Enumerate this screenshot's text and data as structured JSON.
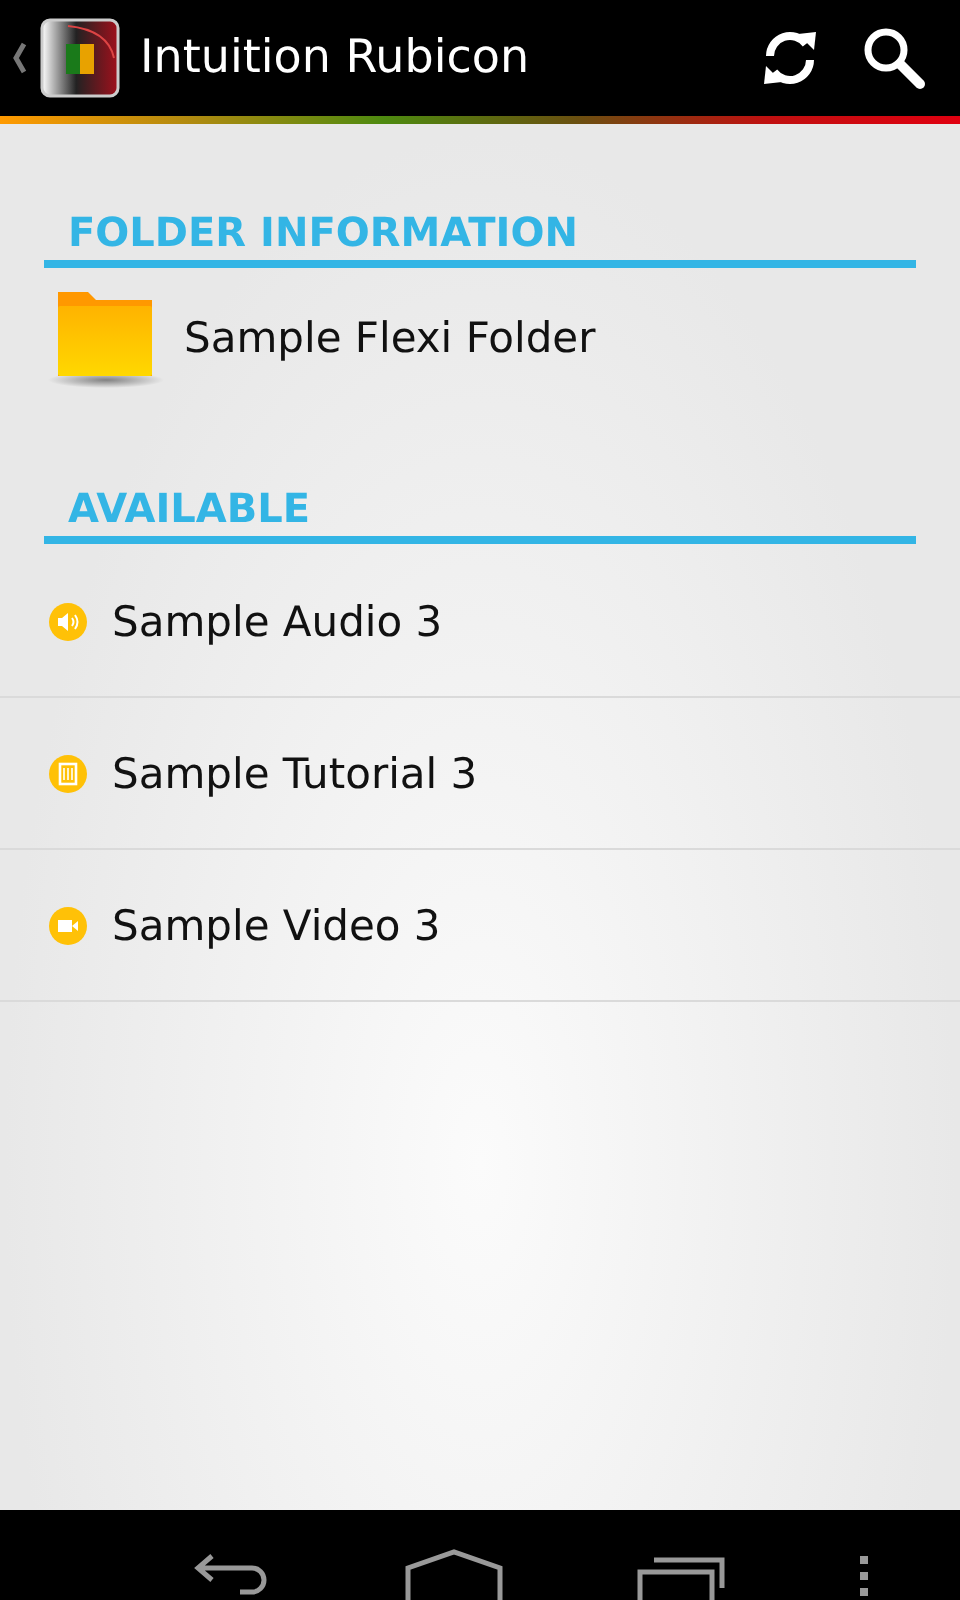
{
  "action_bar": {
    "title": "Intuition Rubicon"
  },
  "folder_section": {
    "heading": "FOLDER INFORMATION",
    "folder_name": "Sample Flexi Folder"
  },
  "available_section": {
    "heading": "AVAILABLE",
    "items": [
      {
        "kind": "audio",
        "label": "Sample Audio 3"
      },
      {
        "kind": "tutorial",
        "label": "Sample Tutorial 3"
      },
      {
        "kind": "video",
        "label": "Sample Video 3"
      }
    ]
  }
}
